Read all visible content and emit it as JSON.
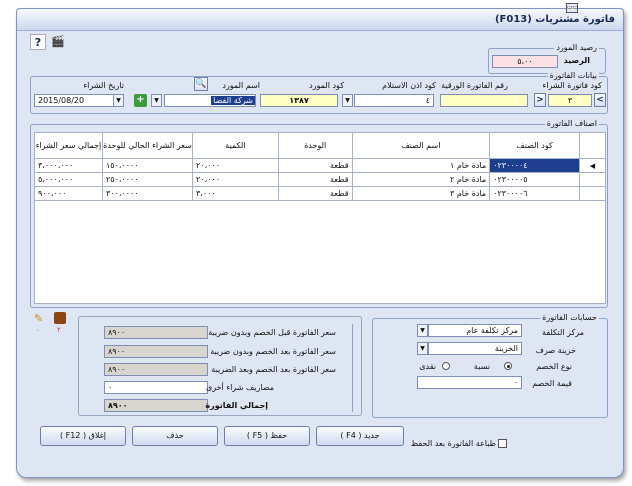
{
  "window": {
    "title": "فاتورة مشتريات (F013)",
    "control_symbol": "▭▭"
  },
  "toolbar": {
    "help_icon": "?",
    "clapper_icon": "🎬"
  },
  "balance": {
    "group_label": "رصيد المورد",
    "field_label": "الرصيد",
    "value": "٥،٠٠"
  },
  "invoice_data": {
    "group_label": "بيانات الفاتورة",
    "nav_prev": "<",
    "nav_next": ">",
    "purchase_code_label": "كود فاتورة الشراء",
    "purchase_code": "٣",
    "paper_invoice_label": "رقم الفاتورة الورقية",
    "paper_invoice": "",
    "receipt_code_label": "كود اذن الاستلام",
    "receipt_code": "٤",
    "supplier_code_label": "كود المورد",
    "supplier_code": "١٣٨٧",
    "supplier_name_label": "اسم المورد",
    "supplier_name": "شركة الفضا",
    "purchase_date_label": "تاريخ الشراء",
    "purchase_date": "2015/08/20"
  },
  "items": {
    "group_label": "اصناف الفاتورة",
    "columns": [
      "كود الصنف",
      "اسم الصنف",
      "الوحدة",
      "الكمية",
      "سعر الشراء الحالي للوحدة",
      "إجمالي سعر الشراء"
    ],
    "rows": [
      [
        "٠٢٣٠٠٠٠٤",
        "مادة خام ١",
        "قطعة",
        "٢٠،٠٠٠",
        "١٥٠،٠٠٠٠",
        "٣،٠٠٠،٠٠٠"
      ],
      [
        "٠٢٣٠٠٠٠٥",
        "مادة خام ٢",
        "قطعة",
        "٢٠،٠٠٠",
        "٢٥٠،٠٠٠٠",
        "٥،٠٠٠،٠٠٠"
      ],
      [
        "٠٢٣٠٠٠٠٦",
        "مادة خام ٣",
        "قطعة",
        "٣،٠٠٠",
        "٣٠٠،٠٠٠٠",
        "٩٠٠،٠٠٠"
      ]
    ]
  },
  "accounts": {
    "group_label": "حسابات الفاتورة",
    "cost_center_label": "مركز التكلفة",
    "cost_center": "مركز تكلفة عام",
    "treasury_label": "خزينة صرف",
    "treasury": "الخزينة",
    "discount_type_label": "نوع الخصم",
    "discount_percent_label": "نسبة",
    "discount_cash_label": "نقدى",
    "discount_value_label": "قيمة الخصم",
    "discount_value": "٠"
  },
  "totals": {
    "before_label": "سعر الفاتورة قبل الخصم وبدون ضريبة",
    "before_value": "٨٩٠٠",
    "after_discount_label": "سعر الفاتورة بعد الخصم وبدون ضريبة",
    "after_discount_value": "٨٩٠٠",
    "after_tax_label": "سعر الفاتورة بعد الخصم وبعد الضريبة",
    "after_tax_value": "٨٩٠٠",
    "other_label": "مصاريف شراء أخرى",
    "other_value": "٠",
    "total_label": "إجمالي الفاتورة",
    "total_value": "٨٩٠٠"
  },
  "side_icons": {
    "attach_count": "٠",
    "box_count": "٢"
  },
  "footer": {
    "print_after_save_label": "طباعة الفاتورة بعد الحفظ",
    "new_label": "جديد ( F4 )",
    "save_label": "حفظ ( F5 )",
    "delete_label": "حذف",
    "close_label": "إغلاق ( F12 )"
  }
}
